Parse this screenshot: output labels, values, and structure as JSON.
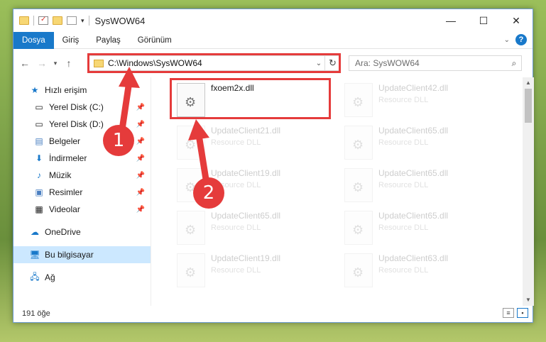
{
  "window": {
    "title": "SysWOW64",
    "controls": {
      "minimize": "—",
      "maximize": "☐",
      "close": "✕"
    }
  },
  "ribbon": {
    "tabs": [
      "Dosya",
      "Giriş",
      "Paylaş",
      "Görünüm"
    ],
    "active_tab": "Dosya",
    "accent_color": "#1979ca"
  },
  "address": {
    "path": "C:\\Windows\\SysWOW64",
    "search_placeholder": "Ara: SysWOW64"
  },
  "nav": {
    "items": [
      {
        "label": "Hızlı erişim",
        "icon": "star-icon",
        "pinned": false
      },
      {
        "label": "Yerel Disk (C:)",
        "icon": "drive-icon",
        "pinned": true
      },
      {
        "label": "Yerel Disk (D:)",
        "icon": "drive-icon",
        "pinned": true
      },
      {
        "label": "Belgeler",
        "icon": "documents-icon",
        "pinned": true
      },
      {
        "label": "İndirmeler",
        "icon": "download-icon",
        "pinned": true
      },
      {
        "label": "Müzik",
        "icon": "music-icon",
        "pinned": true
      },
      {
        "label": "Resimler",
        "icon": "pictures-icon",
        "pinned": true
      },
      {
        "label": "Videolar",
        "icon": "videos-icon",
        "pinned": true
      },
      {
        "label": "OneDrive",
        "icon": "cloud-icon",
        "pinned": false
      },
      {
        "label": "Bu bilgisayar",
        "icon": "computer-icon",
        "pinned": false,
        "selected": true
      },
      {
        "label": "Ağ",
        "icon": "network-icon",
        "pinned": false
      }
    ]
  },
  "files": [
    {
      "name": "fxoem2x.dll",
      "type": "",
      "highlighted": true
    },
    {
      "name": "UpdateClient42.dll",
      "type": "Resource DLL"
    },
    {
      "name": "UpdateClient21.dll",
      "type": "Resource DLL"
    },
    {
      "name": "UpdateClient65.dll",
      "type": "Resource DLL"
    },
    {
      "name": "UpdateClient19.dll",
      "type": "Resource DLL"
    },
    {
      "name": "UpdateClient65.dll",
      "type": "Resource DLL"
    },
    {
      "name": "UpdateClient65.dll",
      "type": "Resource DLL"
    },
    {
      "name": "UpdateClient65.dll",
      "type": "Resource DLL"
    },
    {
      "name": "UpdateClient19.dll",
      "type": "Resource DLL"
    },
    {
      "name": "UpdateClient63.dll",
      "type": "Resource DLL"
    }
  ],
  "status": {
    "item_count": "191 öğe"
  },
  "annotations": {
    "badge1": "1",
    "badge2": "2",
    "highlight_color": "#e53b3b"
  }
}
